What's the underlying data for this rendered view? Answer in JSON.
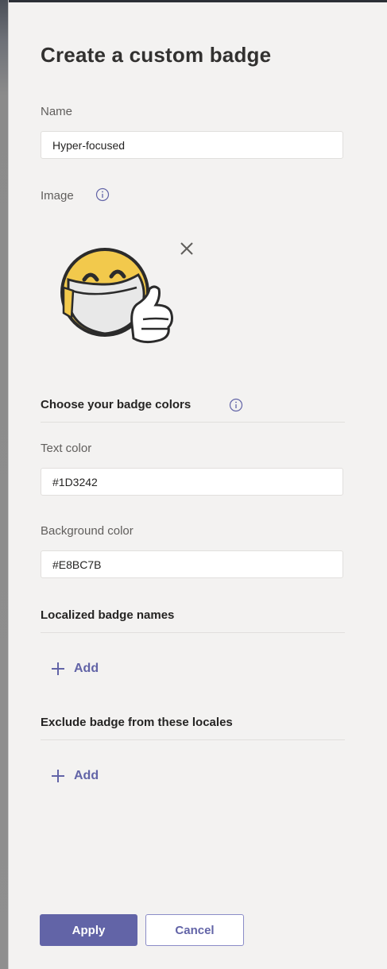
{
  "panel": {
    "title": "Create a custom badge"
  },
  "name_field": {
    "label": "Name",
    "value": "Hyper-focused"
  },
  "image_section": {
    "label": "Image",
    "image_icon": "smiling-face-mask-thumbs-up-icon",
    "info_icon": "info-circle-icon",
    "remove_icon": "close-icon"
  },
  "colors_section": {
    "heading": "Choose your badge colors",
    "info_icon": "info-circle-icon",
    "text_color": {
      "label": "Text color",
      "value": "#1D3242"
    },
    "background_color": {
      "label": "Background color",
      "value": "#E8BC7B"
    }
  },
  "localized_names": {
    "heading": "Localized badge names",
    "add_label": "Add",
    "add_icon": "plus-icon"
  },
  "exclude_locales": {
    "heading": "Exclude badge from these locales",
    "add_label": "Add",
    "add_icon": "plus-icon"
  },
  "footer": {
    "apply_label": "Apply",
    "cancel_label": "Cancel"
  },
  "colors": {
    "accent": "#6264A7",
    "panel_background": "#F3F2F1",
    "input_background": "#FFFFFF",
    "emoji_yellow": "#F2C94C"
  }
}
